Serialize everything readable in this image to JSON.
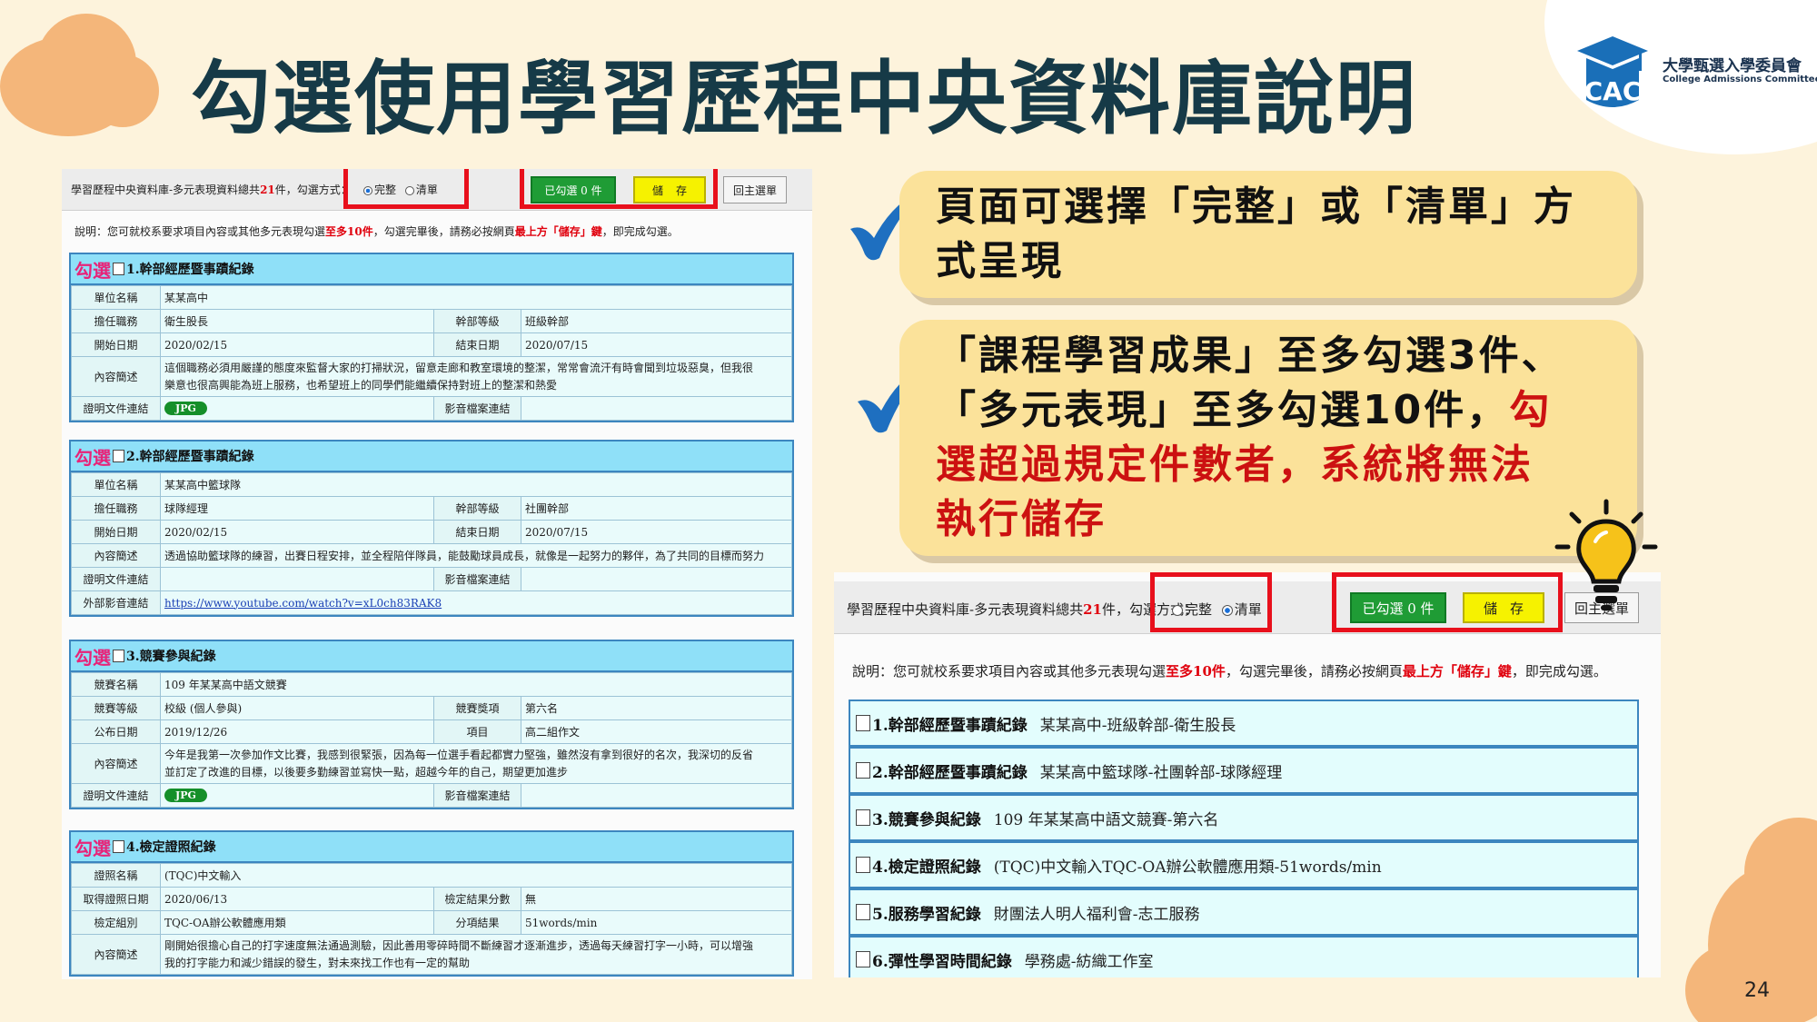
{
  "slide": {
    "title": "勾選使用學習歷程中央資料庫說明",
    "page_number": "24",
    "logo_cn": "大學甄選入學委員會",
    "logo_en": "College Admissions Committee",
    "logo_mark": "CAC"
  },
  "left_shot": {
    "header_text": "學習歷程中央資料庫-多元表現資料總共",
    "total": "21",
    "header_suffix": "件，勾選方式：",
    "radio_full": "完整",
    "radio_list": "清單",
    "selected_btn": "已勾選 0 件",
    "save_btn": "儲存",
    "menu_btn": "回主選單",
    "note_a": "說明：您可就校系要求項目內容或其他多元表現勾選",
    "note_b": "至多10件",
    "note_c": "，勾選完畢後，請務必按網頁",
    "note_d": "最上方「儲存」鍵",
    "note_e": "，即完成勾選。",
    "check_label": "勾選",
    "jpg": "JPG",
    "records": [
      {
        "title": "1.幹部經歷暨事蹟紀錄",
        "unit_label": "單位名稱",
        "unit": "某某高中",
        "role_label": "擔任職務",
        "role": "衛生股長",
        "level_label": "幹部等級",
        "level": "班級幹部",
        "start_label": "開始日期",
        "start": "2020/02/15",
        "end_label": "結束日期",
        "end": "2020/07/15",
        "desc_label": "內容簡述",
        "desc1": "這個職務必須用嚴謹的態度來監督大家的打掃狀況，留意走廊和教室環境的整潔，常常會流汗有時會聞到垃圾惡臭，但我很",
        "desc2": "樂意也很高興能為班上服務，也希望班上的同學們能繼續保持對班上的整潔和熱愛",
        "proof_label": "證明文件連結",
        "media_label": "影音檔案連結"
      },
      {
        "title": "2.幹部經歷暨事蹟紀錄",
        "unit_label": "單位名稱",
        "unit": "某某高中籃球隊",
        "role_label": "擔任職務",
        "role": "球隊經理",
        "level_label": "幹部等級",
        "level": "社團幹部",
        "start_label": "開始日期",
        "start": "2020/02/15",
        "end_label": "結束日期",
        "end": "2020/07/15",
        "desc_label": "內容簡述",
        "desc1": "透過協助籃球隊的練習，出賽日程安排，並全程陪伴隊員，能鼓勵球員成長，就像是一起努力的夥伴，為了共同的目標而努力",
        "proof_label": "證明文件連結",
        "media_label": "影音檔案連結",
        "ext_label": "外部影音連結",
        "ext": "https://www.youtube.com/watch?v=xL0ch83RAK8"
      },
      {
        "title": "3.競賽參與紀錄",
        "name_label": "競賽名稱",
        "name": "109 年某某高中語文競賽",
        "level_label": "競賽等級",
        "level": "校級 (個人參與)",
        "award_label": "競賽獎項",
        "award": "第六名",
        "date_label": "公布日期",
        "date": "2019/12/26",
        "item_label": "項目",
        "item": "高二組作文",
        "desc_label": "內容簡述",
        "desc1": "今年是我第一次參加作文比賽，我感到很緊張，因為每一位選手看起都實力堅強，雖然沒有拿到很好的名次，我深切的反省",
        "desc2": "並訂定了改進的目標，以後要多勤練習並寫快一點，超越今年的自己，期望更加進步",
        "proof_label": "證明文件連結",
        "media_label": "影音檔案連結"
      },
      {
        "title": "4.檢定證照紀錄",
        "cert_label": "證照名稱",
        "cert": "(TQC)中文輸入",
        "got_label": "取得證照日期",
        "got": "2020/06/13",
        "score_label": "檢定結果分數",
        "score": "無",
        "group_label": "檢定組別",
        "group": "TQC-OA辦公軟體應用類",
        "result_label": "分項結果",
        "result": "51words/min",
        "desc_label": "內容簡述",
        "desc1": "剛開始很擔心自己的打字速度無法通過測驗，因此善用零碎時間不斷練習才逐漸進步，透過每天練習打字一小時，可以增強",
        "desc2": "我的打字能力和減少錯誤的發生，對未來找工作也有一定的幫助"
      }
    ]
  },
  "right_shot": {
    "header_text": "學習歷程中央資料庫-多元表現資料總共",
    "total": "21",
    "header_suffix": "件，勾選方式：",
    "radio_full": "完整",
    "radio_list": "清單",
    "selected_btn": "已勾選 0 件",
    "save_btn": "儲存",
    "menu_btn": "回主選單",
    "note_a": "說明：您可就校系要求項目內容或其他多元表現勾選",
    "note_b": "至多10件",
    "note_c": "，勾選完畢後，請務必按網頁",
    "note_d": "最上方「儲存」鍵",
    "note_e": "，即完成勾選。",
    "items": [
      {
        "title": "1.幹部經歷暨事蹟紀錄",
        "detail": "某某高中-班級幹部-衛生股長"
      },
      {
        "title": "2.幹部經歷暨事蹟紀錄",
        "detail": "某某高中籃球隊-社團幹部-球隊經理"
      },
      {
        "title": "3.競賽參與紀錄",
        "detail": "109 年某某高中語文競賽-第六名"
      },
      {
        "title": "4.檢定證照紀錄",
        "detail": "(TQC)中文輸入TQC-OA辦公軟體應用類-51words/min"
      },
      {
        "title": "5.服務學習紀錄",
        "detail": "財團法人明人福利會-志工服務"
      },
      {
        "title": "6.彈性學習時間紀錄",
        "detail": "學務處-紡織工作室"
      }
    ]
  },
  "callouts": {
    "first_l1": "頁面可選擇「完整」或「清單」方",
    "first_l2": "式呈現",
    "second_l1": "「課程學習成果」至多勾選3件、",
    "second_l2a": "「多元表現」至多勾選10件，",
    "second_l2b": "勾",
    "second_l3": "選超過規定件數者，系統將無法",
    "second_l4": "執行儲存"
  },
  "icons": [
    "check-icon",
    "lightbulb-icon",
    "cap-icon"
  ],
  "colors": {
    "title": "#163a47",
    "highlight_box": "#e8101c",
    "callout_bg": "#fbe29a",
    "green_btn": "#1f9c35",
    "yellow_btn": "#f6f200",
    "record_head": "#8fe0f8"
  }
}
